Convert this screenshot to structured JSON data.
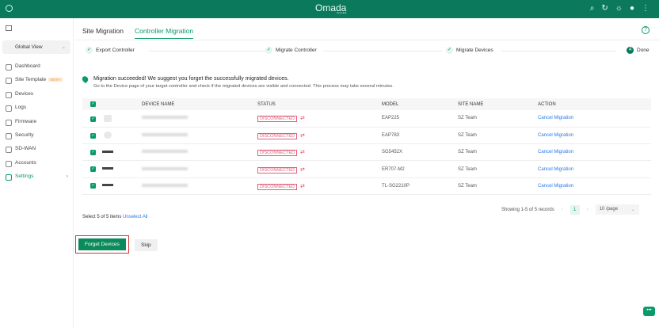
{
  "header": {
    "logo": "Omada",
    "logo_sub": "by tp-link",
    "icons": [
      "search-icon",
      "refresh-icon",
      "theme-icon",
      "avatar-icon",
      "more-icon"
    ]
  },
  "sidebar": {
    "site_selector": "Global View",
    "items": [
      {
        "label": "Dashboard"
      },
      {
        "label": "Site Template",
        "badge": "BETA"
      },
      {
        "label": "Devices"
      },
      {
        "label": "Logs"
      },
      {
        "label": "Firmware"
      },
      {
        "label": "Security"
      },
      {
        "label": "SD-WAN"
      },
      {
        "label": "Accounts"
      },
      {
        "label": "Settings",
        "active": true
      }
    ]
  },
  "tabs": [
    {
      "label": "Site Migration"
    },
    {
      "label": "Controller Migration",
      "active": true
    }
  ],
  "steps": [
    {
      "label": "Export Controller",
      "done": true
    },
    {
      "label": "Migrate Controller",
      "done": true
    },
    {
      "label": "Migrate Devices",
      "done": true
    },
    {
      "label": "Done",
      "number": "4"
    }
  ],
  "message": {
    "title": "Migration succeeded! We suggest you forget the successfully migrated devices.",
    "detail": "Go to the Device page of your target controller and check if the migrated devices are visible and connected. This process may take several minutes."
  },
  "table": {
    "columns": [
      "DEVICE NAME",
      "STATUS",
      "MODEL",
      "SITE NAME",
      "ACTION"
    ],
    "rows": [
      {
        "status": "DISCONNECTED",
        "model": "EAP225",
        "site": "SZ Team",
        "action": "Cancel Migration",
        "type": "ap"
      },
      {
        "status": "DISCONNECTED",
        "model": "EAP783",
        "site": "SZ Team",
        "action": "Cancel Migration",
        "type": "ap-round"
      },
      {
        "status": "DISCONNECTED",
        "model": "SG5452X",
        "site": "SZ Team",
        "action": "Cancel Migration",
        "type": "switch"
      },
      {
        "status": "DISCONNECTED",
        "model": "ER707-M2",
        "site": "SZ Team",
        "action": "Cancel Migration",
        "type": "router"
      },
      {
        "status": "DISCONNECTED",
        "model": "TL-SG2210P",
        "site": "SZ Team",
        "action": "Cancel Migration",
        "type": "switch"
      }
    ]
  },
  "pagination": {
    "summary": "Showing 1-5 of 5 records",
    "page": "1",
    "per_page": "10 /page"
  },
  "selection": {
    "text": "Select 5 of 5 items",
    "unselect": "Unselect All"
  },
  "buttons": {
    "forget": "Forget Devices",
    "skip": "Skip"
  },
  "colors": {
    "brand": "#0b7a5c",
    "accent": "#0b9a6a",
    "error": "#e0607a",
    "link": "#2a7ae2"
  }
}
